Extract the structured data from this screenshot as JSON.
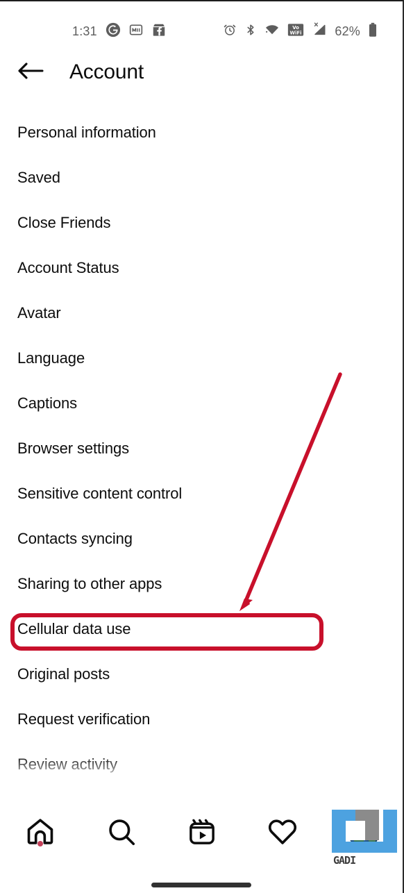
{
  "status_bar": {
    "time": "1:31",
    "battery_percent": "62%",
    "left_icons": [
      "google-icon",
      "medium-icon",
      "facebook-marketplace-icon"
    ],
    "right_icons": [
      "alarm-icon",
      "bluetooth-icon",
      "wifi-icon",
      "volte-wifi-icon",
      "cellular-signal-x-icon",
      "battery-icon"
    ],
    "icon_color": "#5d5d5d"
  },
  "header": {
    "back_label": "back",
    "title": "Account"
  },
  "settings": {
    "items": [
      {
        "label": "Personal information"
      },
      {
        "label": "Saved"
      },
      {
        "label": "Close Friends"
      },
      {
        "label": "Account Status"
      },
      {
        "label": "Avatar"
      },
      {
        "label": "Language"
      },
      {
        "label": "Captions"
      },
      {
        "label": "Browser settings"
      },
      {
        "label": "Sensitive content control"
      },
      {
        "label": "Contacts syncing"
      },
      {
        "label": "Sharing to other apps"
      },
      {
        "label": "Cellular data use"
      },
      {
        "label": "Original posts"
      },
      {
        "label": "Request verification"
      },
      {
        "label": "Review activity"
      }
    ],
    "highlighted_item": "Cellular data use"
  },
  "annotations": {
    "highlight_color": "#c8102b",
    "arrow_color": "#c8102b",
    "arrow_from": "490,537",
    "arrow_to": "347,875",
    "target_label": "Cellular data use"
  },
  "bottom_nav": {
    "items": [
      {
        "name": "home",
        "icon": "home-icon",
        "badge_dot": true
      },
      {
        "name": "search",
        "icon": "search-icon",
        "badge_dot": false
      },
      {
        "name": "reels",
        "icon": "reels-icon",
        "badge_dot": false
      },
      {
        "name": "activity",
        "icon": "heart-icon",
        "badge_dot": false
      },
      {
        "name": "profile",
        "icon": "avatar",
        "badge_dot": false
      }
    ]
  },
  "watermark": {
    "text": "GADI",
    "color": "#4da2e0"
  }
}
